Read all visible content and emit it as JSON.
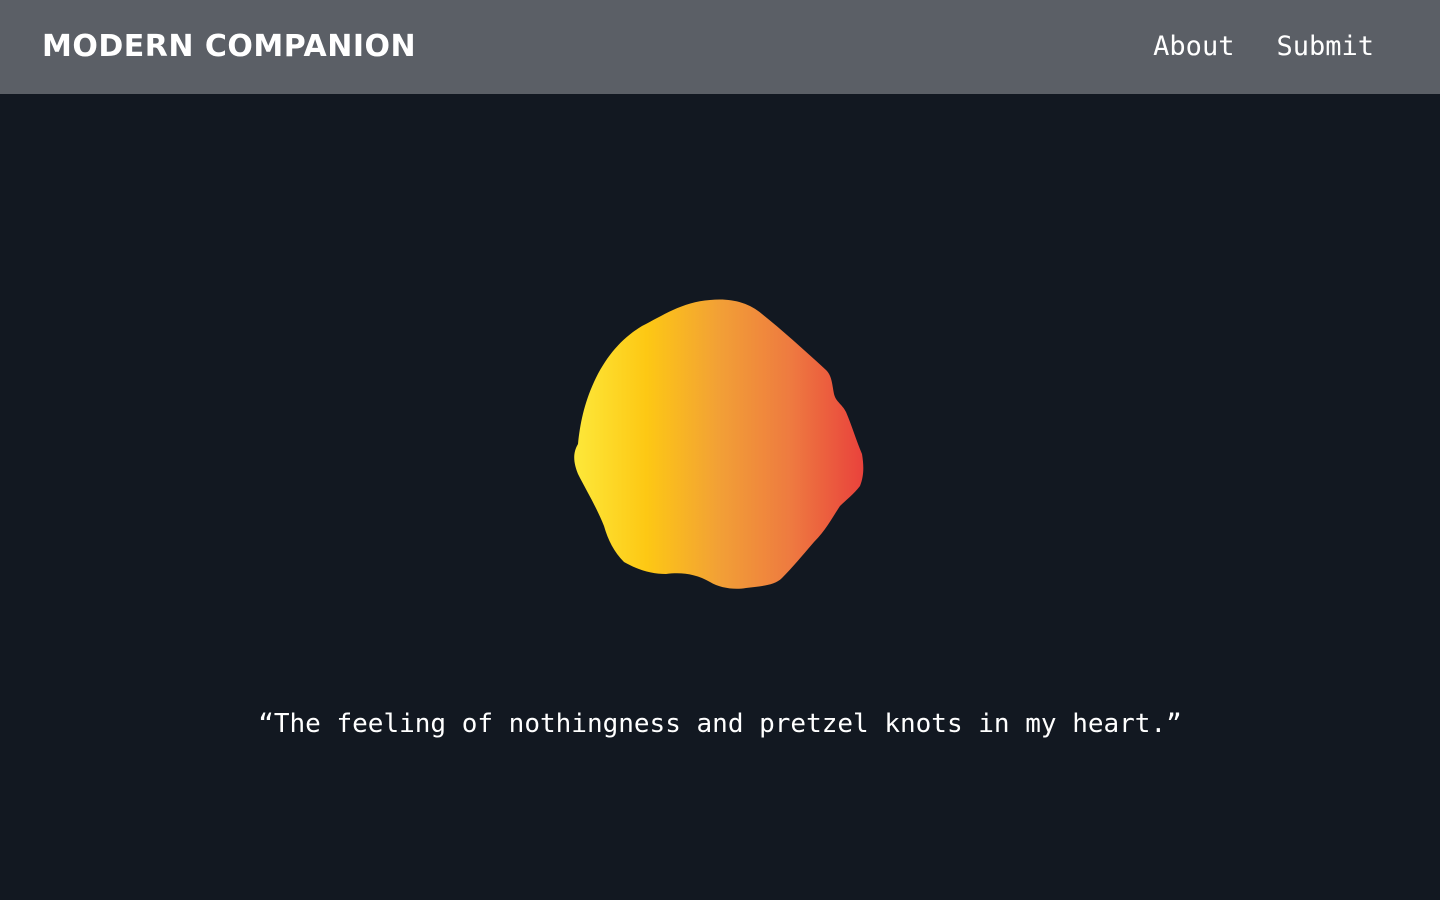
{
  "header": {
    "logo_text": "MODERN COMPANION",
    "background": "#5b5f66",
    "nav": [
      {
        "label": "About"
      },
      {
        "label": "Submit"
      }
    ]
  },
  "main": {
    "background": "#121821",
    "blob": {
      "gradient_colors": [
        "#fde83a",
        "#fdc814",
        "#f2a036",
        "#ee7a40",
        "#e9423c"
      ]
    },
    "quote": "“The feeling of nothingness and pretzel knots in my heart.”"
  }
}
